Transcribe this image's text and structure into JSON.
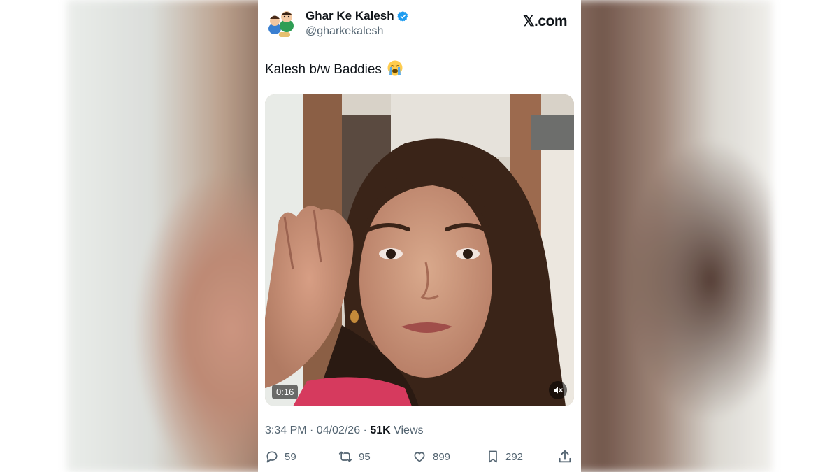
{
  "tweet": {
    "display_name": "Ghar Ke Kalesh",
    "handle": "@gharkekalesh",
    "brand": "𝕏.com",
    "text": "Kalesh b/w Baddies",
    "emoji": "😭",
    "video_duration": "0:16",
    "timestamp": "3:34 PM · 04/02/26 · ",
    "views_count": "51K",
    "views_label": " Views"
  },
  "actions": {
    "replies": "59",
    "reposts": "95",
    "likes": "899",
    "bookmarks": "292"
  },
  "icons": [
    "verified-badge-icon",
    "reply-icon",
    "repost-icon",
    "like-icon",
    "bookmark-icon",
    "share-icon",
    "mute-icon"
  ],
  "colors": {
    "verified": "#1d9bf0",
    "text_primary": "#0f1419",
    "text_secondary": "#536471"
  }
}
